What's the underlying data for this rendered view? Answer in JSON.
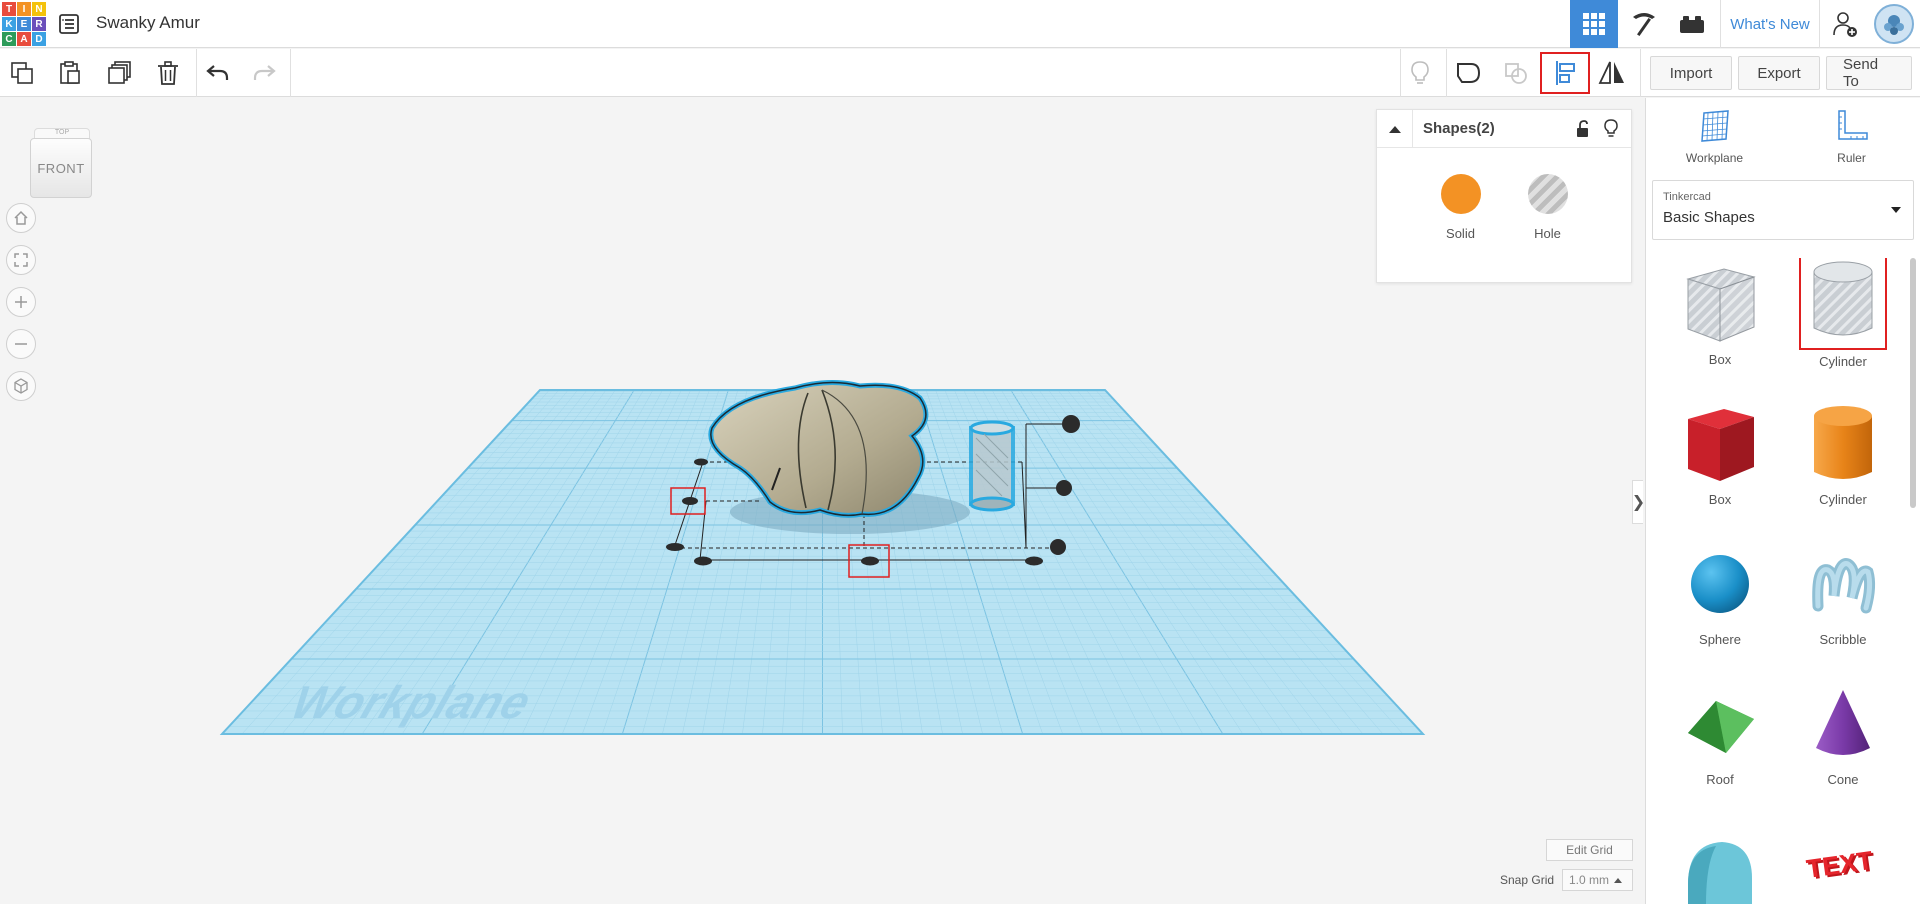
{
  "header": {
    "logo_letters": [
      "T",
      "I",
      "N",
      "K",
      "E",
      "R",
      "C",
      "A",
      "D"
    ],
    "logo_colors": [
      "#e84c3d",
      "#f39224",
      "#f4c20d",
      "#3ba1e3",
      "#3f8ad8",
      "#6b4fbb",
      "#2d9b5a",
      "#e84c3d",
      "#3ba1e3"
    ],
    "project_title": "Swanky Amur",
    "whats_new": "What's New"
  },
  "toolbar": {
    "import_label": "Import",
    "export_label": "Export",
    "sendto_label": "Send To"
  },
  "viewport": {
    "navcube_face": "FRONT",
    "navcube_top": "TOP",
    "workplane_watermark": "Workplane",
    "edit_grid": "Edit Grid",
    "snap_grid_label": "Snap Grid",
    "snap_grid_value": "1.0 mm"
  },
  "inspector": {
    "title": "Shapes(2)",
    "solid_label": "Solid",
    "hole_label": "Hole"
  },
  "rpanel": {
    "workplane_label": "Workplane",
    "ruler_label": "Ruler",
    "category_group": "Tinkercad",
    "category_value": "Basic Shapes",
    "shapes": [
      {
        "label": "Box",
        "icon": "box-hole-icon"
      },
      {
        "label": "Cylinder",
        "icon": "cylinder-hole-icon"
      },
      {
        "label": "Box",
        "icon": "box-red-icon"
      },
      {
        "label": "Cylinder",
        "icon": "cylinder-orange-icon"
      },
      {
        "label": "Sphere",
        "icon": "sphere-icon"
      },
      {
        "label": "Scribble",
        "icon": "scribble-icon"
      },
      {
        "label": "Roof",
        "icon": "roof-icon"
      },
      {
        "label": "Cone",
        "icon": "cone-icon"
      },
      {
        "label": "",
        "icon": "round-roof-icon"
      },
      {
        "label": "",
        "icon": "text-icon"
      }
    ]
  },
  "colors": {
    "accent": "#3f8ad8",
    "highlight": "#e02020",
    "workplane": "#a9dcf0",
    "selection": "#29a9e0"
  }
}
